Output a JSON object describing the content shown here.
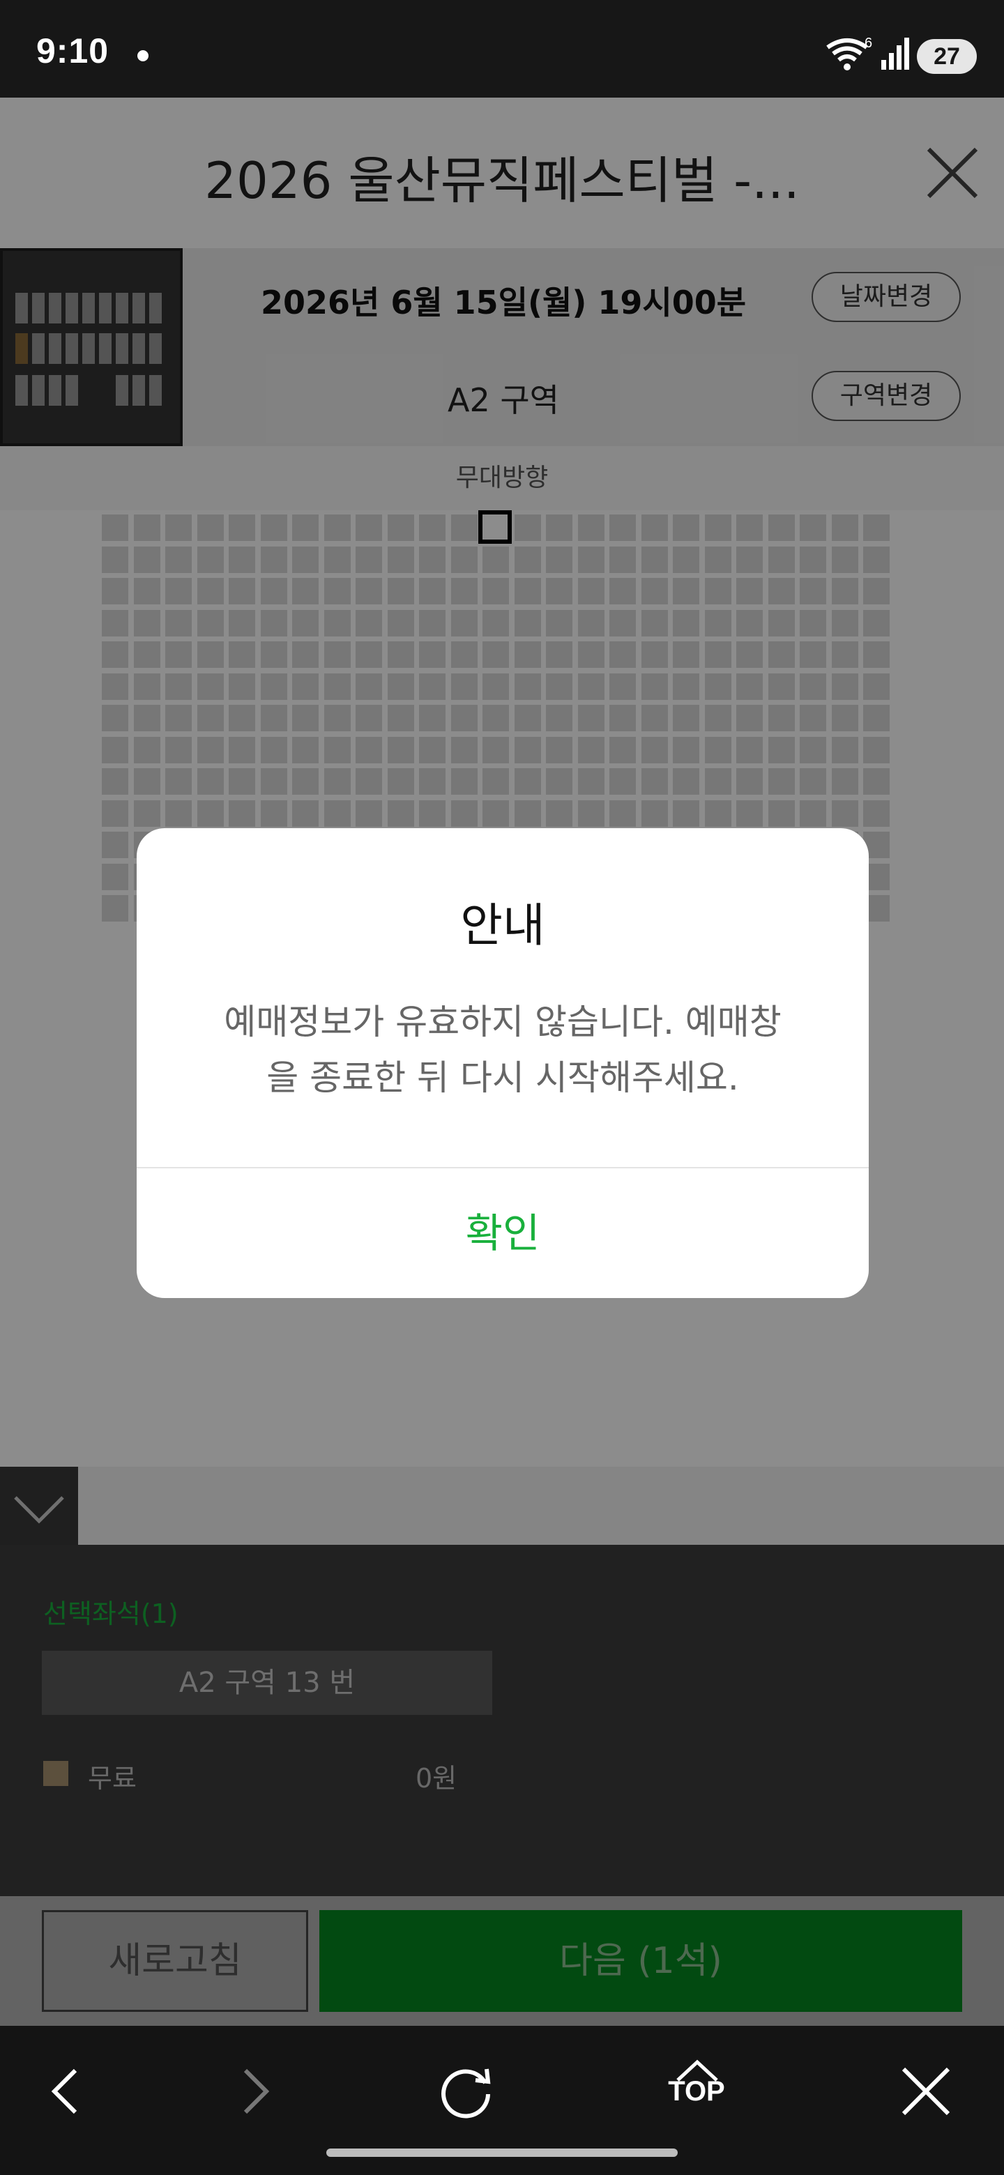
{
  "status_bar": {
    "time": "9:10",
    "wifi_badge": "6",
    "battery": "27"
  },
  "header": {
    "title": "2026 울산뮤직페스티벌 -...",
    "close_icon": "close-icon"
  },
  "booking_info": {
    "date": "2026년 6월 15일(월) 19시00분",
    "zone": "A2 구역",
    "change_date_label": "날짜변경",
    "change_zone_label": "구역변경"
  },
  "stage_label": "무대방향",
  "seat_grid": {
    "rows": 13,
    "cols": 25,
    "selected": {
      "row": 1,
      "col": 13
    }
  },
  "selection": {
    "title": "선택좌석(1)",
    "seat": "A2 구역 13 번",
    "grade_label": "무료",
    "grade_color": "#a8936f",
    "price": "0원"
  },
  "actions": {
    "refresh_label": "새로고침",
    "next_label": "다음 (1석)"
  },
  "dialog": {
    "title": "안내",
    "message_line1": "예매정보가 유효하지 않습니다. 예매창",
    "message_line2": "을 종료한 뒤 다시 시작해주세요.",
    "confirm_label": "확인"
  },
  "bottom_nav": {
    "top_label": "TOP"
  },
  "colors": {
    "accent_green": "#19b03c",
    "button_green": "#05871f"
  }
}
